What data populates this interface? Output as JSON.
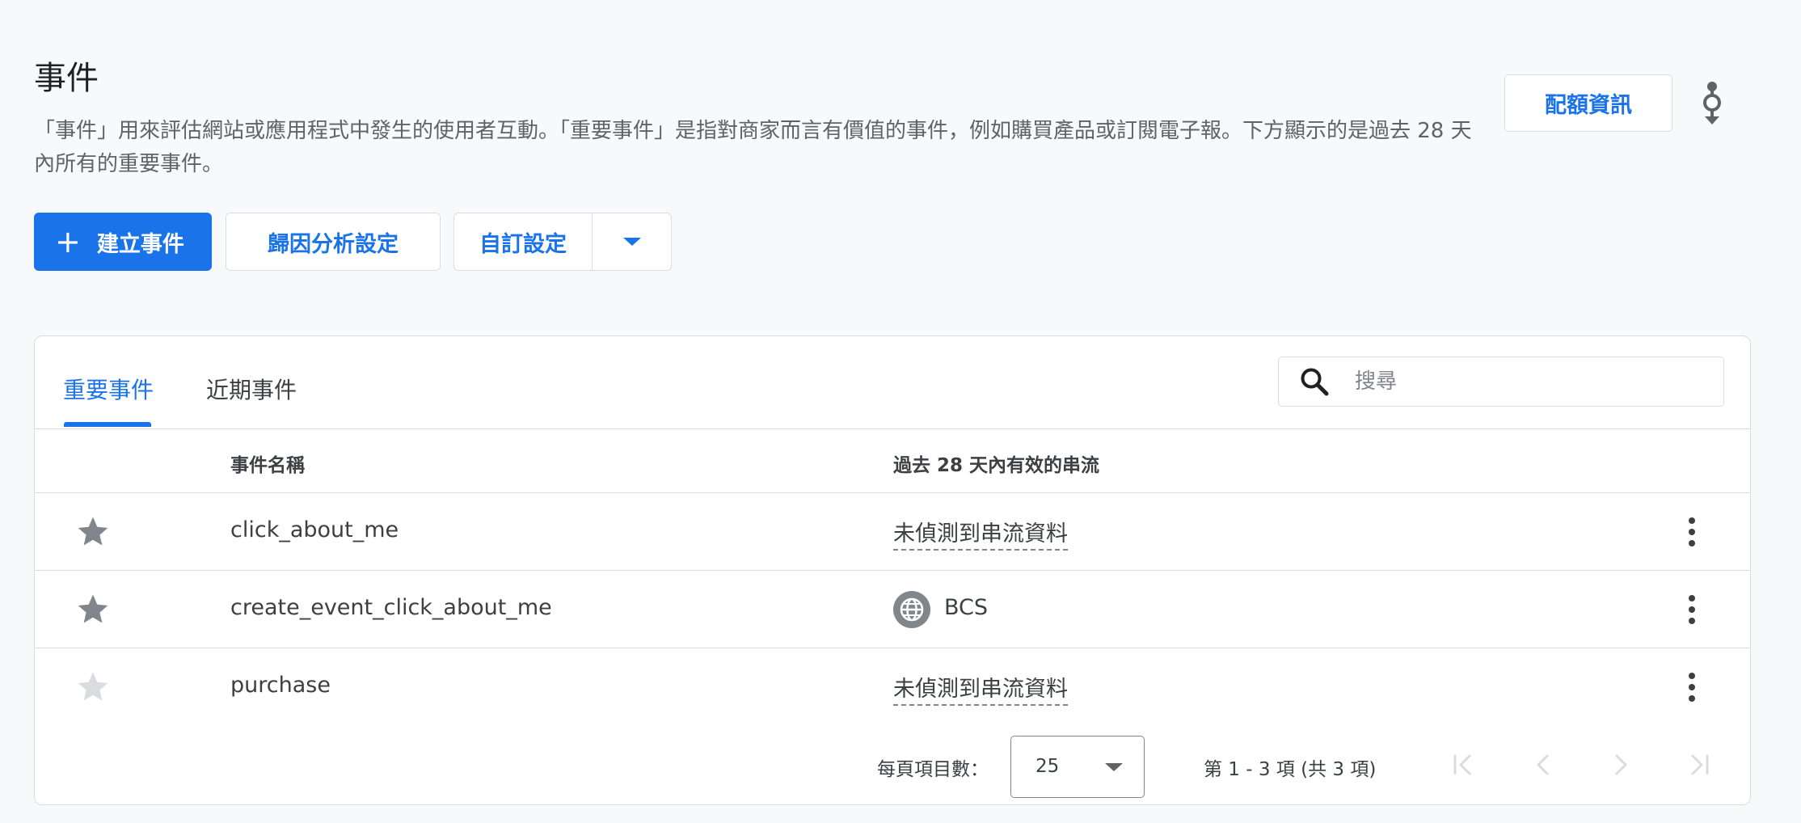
{
  "header": {
    "title": "事件",
    "description": "「事件」用來評估網站或應用程式中發生的使用者互動。「重要事件」是指對商家而言有價值的事件，例如購買產品或訂閱電子報。下方顯示的是過去 28 天內所有的重要事件。",
    "quota_button": "配額資訊",
    "journey_icon": "journey-icon"
  },
  "toolbar": {
    "create_label": "建立事件",
    "create_icon": "plus-icon",
    "attribution_label": "歸因分析設定",
    "custom_label": "自訂設定",
    "custom_dropdown_icon": "caret-down-icon"
  },
  "tabs": [
    {
      "label": "重要事件",
      "active": true
    },
    {
      "label": "近期事件",
      "active": false
    }
  ],
  "search": {
    "placeholder": "搜尋",
    "value": ""
  },
  "table": {
    "columns": [
      "事件名稱",
      "過去 28 天內有效的串流"
    ],
    "rows": [
      {
        "name": "click_about_me",
        "stream": "未偵測到串流資料",
        "stream_icon": null,
        "starred": true
      },
      {
        "name": "create_event_click_about_me",
        "stream": "BCS",
        "stream_icon": "globe-icon",
        "starred": true
      },
      {
        "name": "purchase",
        "stream": "未偵測到串流資料",
        "stream_icon": null,
        "starred": false
      }
    ]
  },
  "pagination": {
    "rows_per_page_label": "每頁項目數：",
    "rows_per_page": "25",
    "range_text": "第 1 - 3 項 (共 3 項)"
  },
  "colors": {
    "accent": "#1a73e8",
    "star_filled": "#80868b",
    "star_empty": "#dadce0",
    "border": "#dadce0",
    "text": "#3c4043"
  }
}
